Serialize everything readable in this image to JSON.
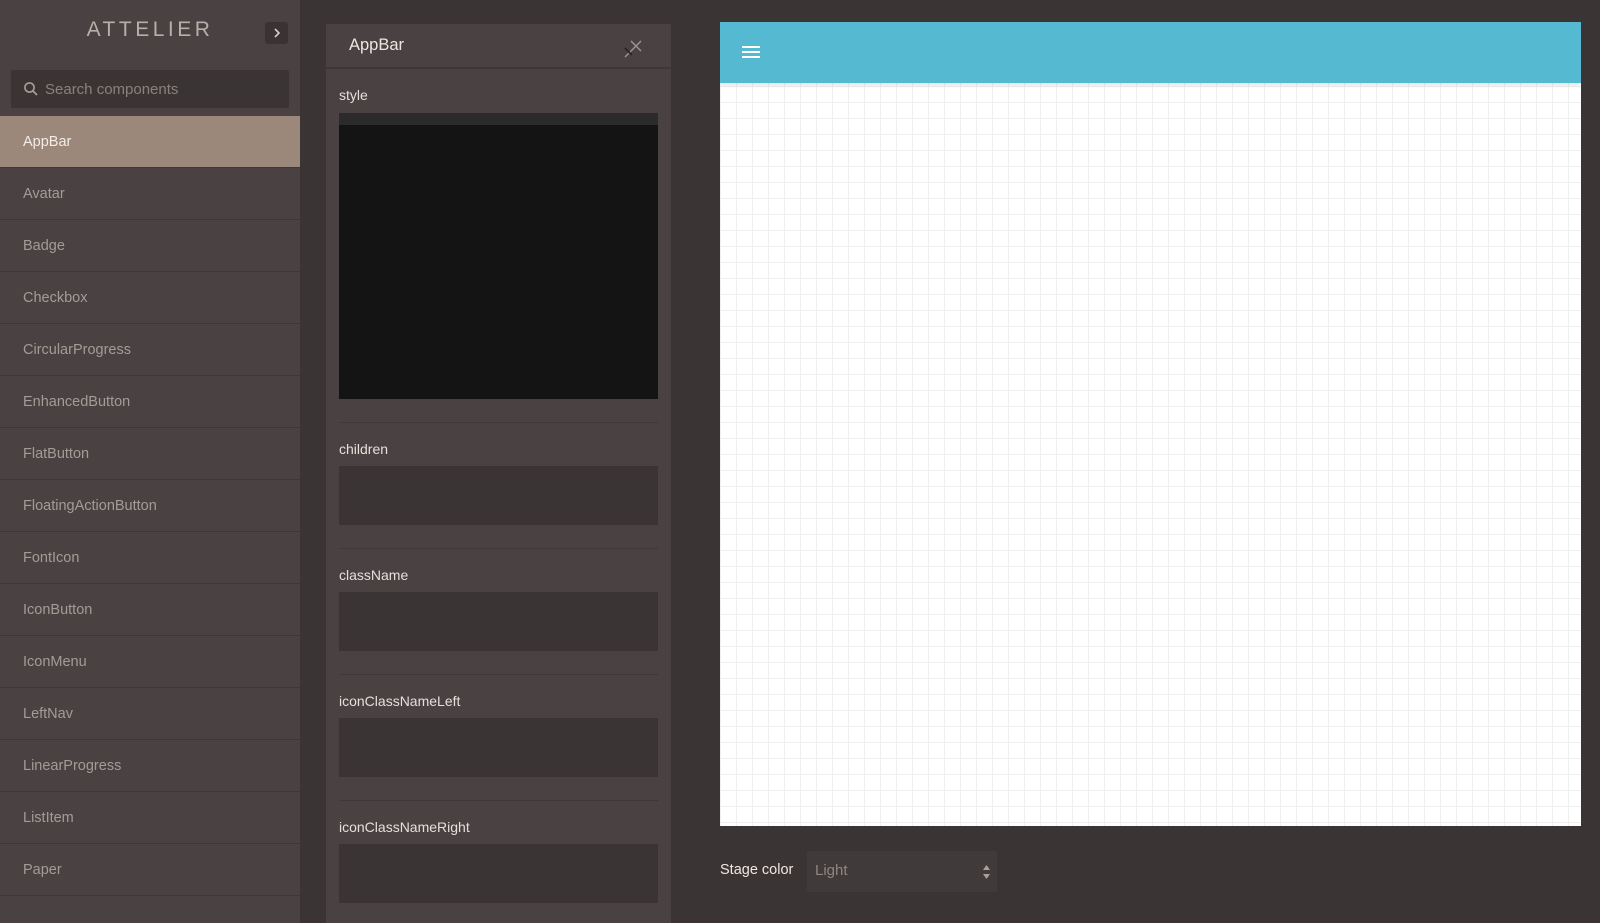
{
  "sidebar": {
    "brand": "ATTELIER",
    "search_placeholder": "Search components",
    "items": [
      {
        "label": "AppBar",
        "active": true
      },
      {
        "label": "Avatar"
      },
      {
        "label": "Badge"
      },
      {
        "label": "Checkbox"
      },
      {
        "label": "CircularProgress"
      },
      {
        "label": "EnhancedButton"
      },
      {
        "label": "FlatButton"
      },
      {
        "label": "FloatingActionButton"
      },
      {
        "label": "FontIcon"
      },
      {
        "label": "IconButton"
      },
      {
        "label": "IconMenu"
      },
      {
        "label": "LeftNav"
      },
      {
        "label": "LinearProgress"
      },
      {
        "label": "ListItem"
      },
      {
        "label": "Paper"
      }
    ]
  },
  "panel": {
    "title": "AppBar",
    "props": [
      {
        "label": "style",
        "value": ""
      },
      {
        "label": "children",
        "value": ""
      },
      {
        "label": "className",
        "value": ""
      },
      {
        "label": "iconClassNameLeft",
        "value": ""
      },
      {
        "label": "iconClassNameRight",
        "value": ""
      }
    ]
  },
  "stage": {
    "appbar_color": "#55bad1",
    "color_label": "Stage color",
    "color_value": "Light"
  },
  "icons": {
    "collapse": "chevron-right-icon",
    "search": "search-icon",
    "close": "close-icon",
    "menu": "menu-icon",
    "select": "select-arrows-icon"
  }
}
